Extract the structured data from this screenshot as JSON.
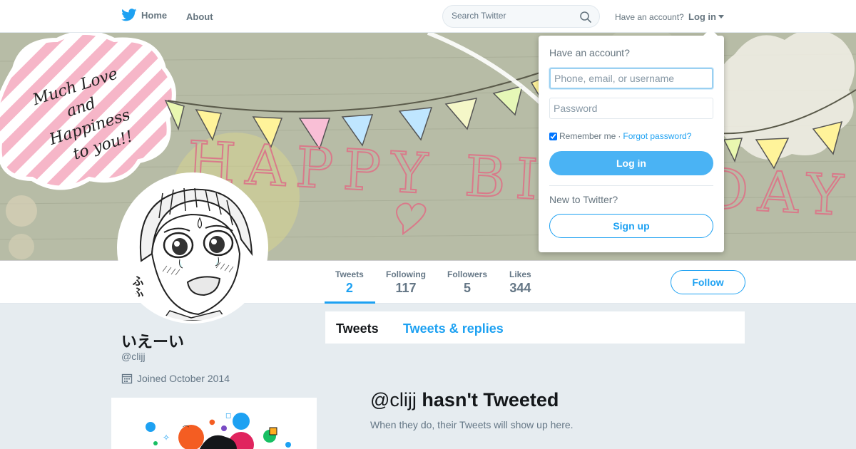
{
  "nav": {
    "home_label": "Home",
    "about_label": "About",
    "search_placeholder": "Search Twitter",
    "have_account": "Have an account?",
    "login_label": "Log in"
  },
  "banner": {
    "sign_text": [
      "Much Love",
      "and",
      "Happiness",
      "to you!!"
    ],
    "headline_text": "HAPPY BIRTHDAY"
  },
  "avatar": {
    "sound_effect": "ふふ"
  },
  "stats": [
    {
      "label": "Tweets",
      "value": "2"
    },
    {
      "label": "Following",
      "value": "117"
    },
    {
      "label": "Followers",
      "value": "5"
    },
    {
      "label": "Likes",
      "value": "344"
    }
  ],
  "follow_label": "Follow",
  "profile": {
    "display_name": "いえーい",
    "screen_name": "@clijj",
    "joined": "Joined October 2014"
  },
  "timeline": {
    "tabs": [
      "Tweets",
      "Tweets & replies"
    ],
    "empty_handle": "@clijj",
    "empty_title_rest": "hasn't Tweeted",
    "empty_subtitle": "When they do, their Tweets will show up here."
  },
  "login_dropdown": {
    "heading": "Have an account?",
    "username_placeholder": "Phone, email, or username",
    "password_placeholder": "Password",
    "remember_label": "Remember me",
    "separator": "·",
    "forgot_label": "Forgot password?",
    "login_button": "Log in",
    "new_label": "New to Twitter?",
    "signup_button": "Sign up"
  },
  "colors": {
    "twitter_blue": "#1da1f2",
    "login_button_blue": "#4ab3f4",
    "page_bg": "#e6ecf0"
  }
}
